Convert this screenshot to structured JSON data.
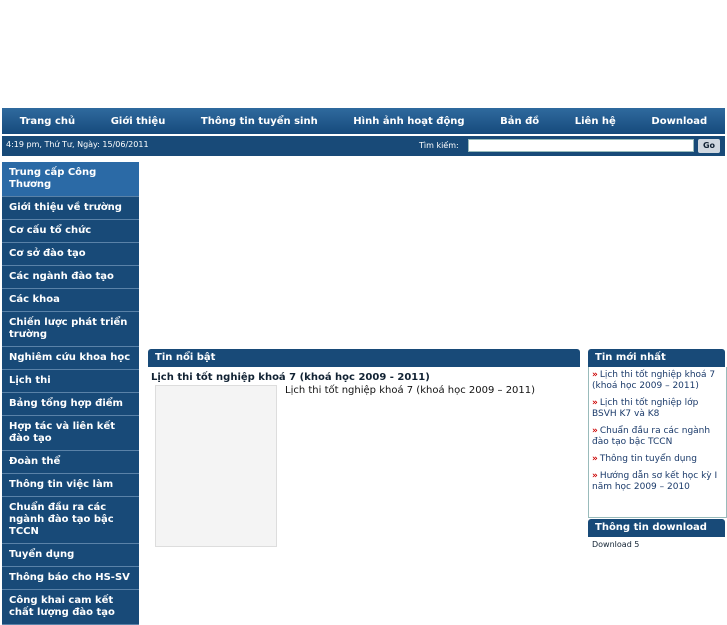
{
  "nav": [
    "Trang chủ",
    "Giới thiệu",
    "Thông tin tuyển sinh",
    "Hình ảnh hoạt động",
    "Bản đồ",
    "Liên hệ",
    "Download"
  ],
  "subbar": {
    "date": "4:19 pm, Thứ Tư, Ngày: 15/06/2011",
    "search_label": "Tìm kiếm:",
    "search_value": "",
    "go": "Go"
  },
  "sidebar": [
    "Trung cấp Công Thương",
    "Giới thiệu về trường",
    "Cơ cấu tổ chức",
    "Cơ sở đào tạo",
    "Các ngành đào tạo",
    "Các khoa",
    "Chiến lược phát triển trường",
    "Nghiêm cứu khoa học",
    "Lịch thi",
    "Bảng tổng hợp điểm",
    "Hợp tác và liên kết đào tạo",
    "Đoàn thể",
    "Thông tin việc làm",
    "Chuẩn đầu ra các ngành đào tạo bậc TCCN",
    "Tuyển dụng",
    "Thông báo cho HS-SV",
    "Công khai cam kết chất lượng đào tạo"
  ],
  "featured": {
    "heading": "Tin nổi bật",
    "title": "Lịch thi tốt nghiệp khoá 7 (khoá học 2009 - 2011)",
    "desc": "Lịch thi tốt nghiệp khoá 7 (khoá học 2009 – 2011)"
  },
  "latest": {
    "heading": "Tin mới nhất",
    "items": [
      "Lịch thi tốt nghiệp khoá 7 (khoá học 2009 – 2011)",
      "Lịch thi tốt nghiệp lớp BSVH K7 và K8",
      "Chuẩn đầu ra các ngành đào tạo bậc TCCN",
      "Thông tin tuyển dụng",
      "Hướng dẫn sơ kết học kỳ I năm học 2009 – 2010"
    ]
  },
  "download": {
    "heading": "Thông tin download",
    "first": "Download 5"
  }
}
